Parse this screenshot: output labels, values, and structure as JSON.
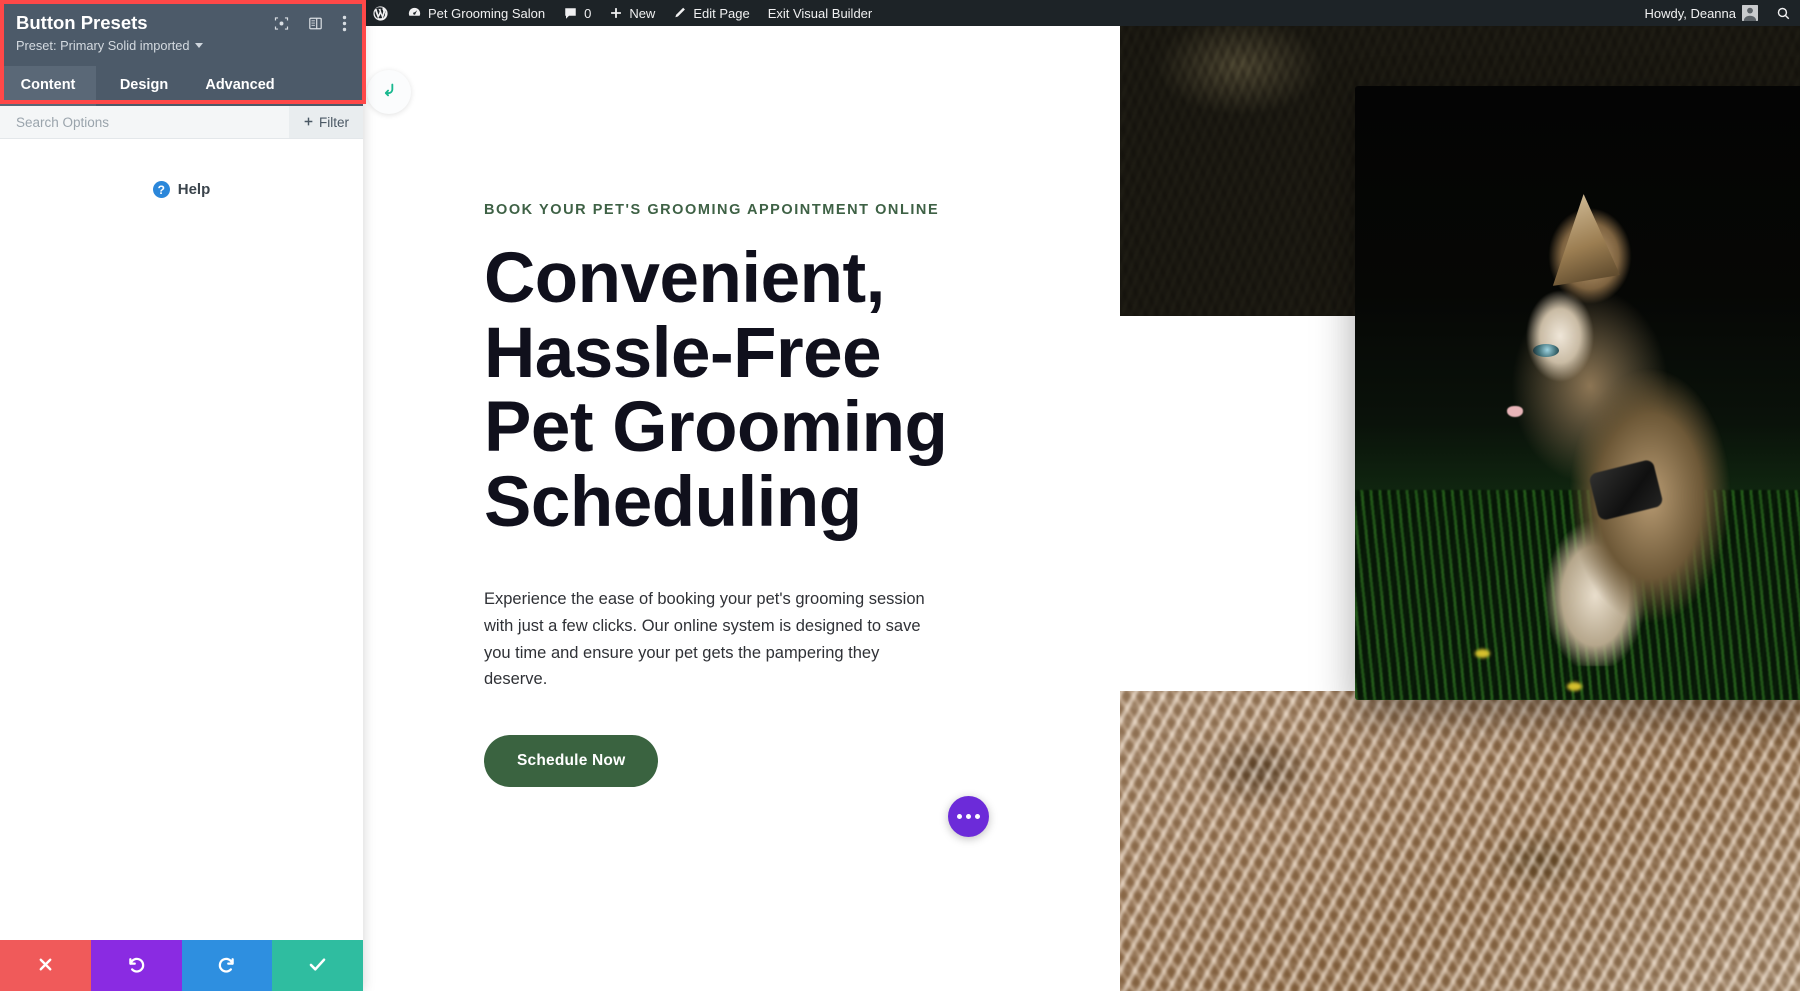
{
  "admin_bar": {
    "wp_logo": "wordpress-logo-icon",
    "site_name": "Pet Grooming Salon",
    "comments_count": "0",
    "new_label": "New",
    "edit_page_label": "Edit Page",
    "exit_builder_label": "Exit Visual Builder",
    "howdy": "Howdy, Deanna",
    "search_icon": "search-icon"
  },
  "divi_panel": {
    "title": "Button Presets",
    "preset_label": "Preset: Primary Solid imported",
    "header_icons": [
      {
        "name": "focus-module-icon"
      },
      {
        "name": "panel-layout-icon"
      },
      {
        "name": "more-options-icon"
      }
    ],
    "tabs": [
      {
        "label": "Content",
        "active": true
      },
      {
        "label": "Design",
        "active": false
      },
      {
        "label": "Advanced",
        "active": false
      }
    ],
    "search_placeholder": "Search Options",
    "filter_label": "Filter",
    "help_label": "Help",
    "help_badge": "?",
    "footer": [
      {
        "name": "cancel-button",
        "icon": "close-icon",
        "color": "#f05a5a"
      },
      {
        "name": "undo-button",
        "icon": "undo-icon",
        "color": "#8a2be2"
      },
      {
        "name": "redo-button",
        "icon": "redo-icon",
        "color": "#2e8fe0"
      },
      {
        "name": "save-button",
        "icon": "check-icon",
        "color": "#2fbda0"
      }
    ],
    "highlight_color": "#ff4848",
    "header_bg": "#4c5a69"
  },
  "hero": {
    "eyebrow": "BOOK YOUR PET'S GROOMING APPOINTMENT ONLINE",
    "title": "Convenient, Hassle-Free Pet Grooming Scheduling",
    "paragraph": "Experience the ease of booking your pet's grooming session with just a few clicks. Our online system is designed to save you time and ensure your pet gets the pampering they deserve.",
    "cta_label": "Schedule Now",
    "eyebrow_color": "#3e6145",
    "cta_color": "#3a6340"
  },
  "floating": {
    "return_icon": "return-arrow-icon",
    "more_icon": "more-dots-icon",
    "more_color": "#6c2bd9"
  }
}
